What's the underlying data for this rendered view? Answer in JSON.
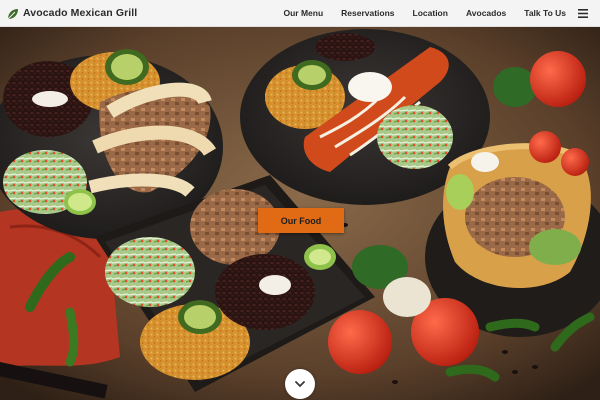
{
  "header": {
    "brand_name": "Avocado Mexican Grill",
    "brand_icon": "avocado-leaf-icon",
    "nav": [
      {
        "label": "Our Menu"
      },
      {
        "label": "Reservations"
      },
      {
        "label": "Location"
      },
      {
        "label": "Avocados"
      },
      {
        "label": "Talk To Us"
      }
    ],
    "menu_icon": "hamburger-menu-icon"
  },
  "hero": {
    "cta_label": "Our Food",
    "scroll_icon": "chevron-down-icon"
  },
  "colors": {
    "accent": "#e06b14",
    "nav_background": "#f4f4f4",
    "text": "#2b2b2b"
  }
}
